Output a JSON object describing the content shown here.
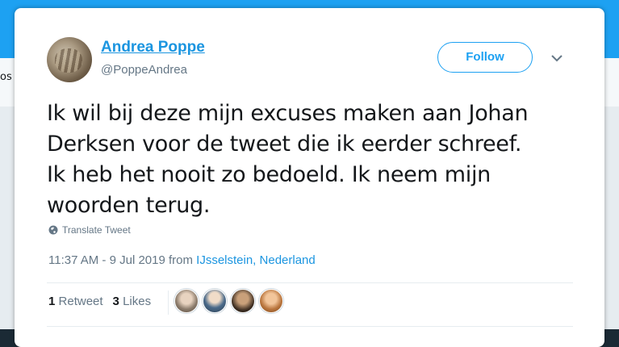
{
  "background": {
    "fragment": "os"
  },
  "tweet": {
    "author": {
      "name": "Andrea Poppe",
      "handle": "@PoppeAndrea"
    },
    "follow_label": "Follow",
    "lines": [
      "Ik wil bij deze mijn excuses maken aan Johan",
      "Derksen voor de tweet die ik eerder schreef.",
      "Ik heb het nooit zo bedoeld. Ik neem mijn",
      "woorden terug."
    ],
    "translate_label": "Translate Tweet",
    "timestamp": "11:37 AM - 9 Jul 2019 from",
    "location": "IJsselstein, Nederland",
    "stats": {
      "retweet_count": "1",
      "retweet_label": "Retweet",
      "like_count": "3",
      "like_label": "Likes"
    }
  },
  "colors": {
    "accent": "#1da1f2",
    "link": "#1b95e0",
    "text": "#14171a",
    "muted": "#657786"
  },
  "icons": [
    "chevron-down-icon",
    "globe-icon"
  ]
}
